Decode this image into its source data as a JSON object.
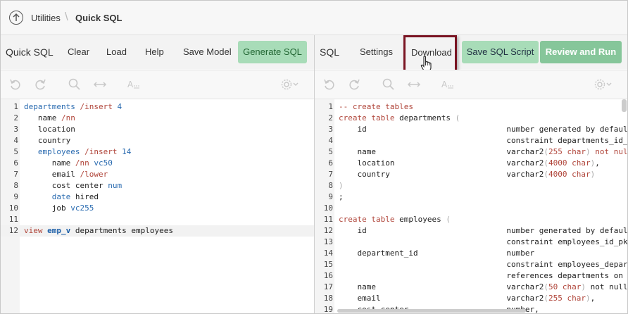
{
  "breadcrumb": {
    "parent": "Utilities",
    "current": "Quick SQL"
  },
  "left_toolbar": {
    "title": "Quick SQL",
    "clear": "Clear",
    "load": "Load",
    "help": "Help",
    "save_model": "Save Model",
    "generate": "Generate SQL"
  },
  "right_toolbar": {
    "title": "SQL",
    "settings": "Settings",
    "download": "Download",
    "save_script": "Save SQL Script",
    "review_run": "Review and Run"
  },
  "colors": {
    "accent_green": "#a8dcb8",
    "run_green": "#86c69a",
    "highlight_border": "#7a1422"
  },
  "left_code": [
    {
      "n": "1",
      "parts": [
        [
          "kw",
          "departments"
        ],
        [
          "red",
          " /insert "
        ],
        [
          "num",
          "4"
        ]
      ]
    },
    {
      "n": "2",
      "parts": [
        [
          "pl",
          "   name "
        ],
        [
          "red",
          "/nn"
        ]
      ]
    },
    {
      "n": "3",
      "parts": [
        [
          "pl",
          "   location"
        ]
      ]
    },
    {
      "n": "4",
      "parts": [
        [
          "pl",
          "   country"
        ]
      ]
    },
    {
      "n": "5",
      "parts": [
        [
          "kw",
          "   employees"
        ],
        [
          "red",
          " /insert "
        ],
        [
          "num",
          "14"
        ]
      ]
    },
    {
      "n": "6",
      "parts": [
        [
          "pl",
          "      name "
        ],
        [
          "red",
          "/nn "
        ],
        [
          "kw",
          "vc50"
        ]
      ]
    },
    {
      "n": "7",
      "parts": [
        [
          "pl",
          "      email "
        ],
        [
          "red",
          "/lower"
        ]
      ]
    },
    {
      "n": "8",
      "parts": [
        [
          "pl",
          "      cost center "
        ],
        [
          "kw",
          "num"
        ]
      ]
    },
    {
      "n": "9",
      "parts": [
        [
          "kw",
          "      date"
        ],
        [
          "pl",
          " hired"
        ]
      ]
    },
    {
      "n": "10",
      "parts": [
        [
          "pl",
          "      job "
        ],
        [
          "kw",
          "vc255"
        ]
      ]
    },
    {
      "n": "11",
      "parts": []
    },
    {
      "n": "12",
      "parts": [
        [
          "red",
          "view "
        ],
        [
          "kwb",
          "emp_v"
        ],
        [
          "pl",
          " departments employees"
        ]
      ]
    }
  ],
  "right_code": [
    {
      "n": "1",
      "parts": [
        [
          "cm",
          "-- create tables"
        ]
      ]
    },
    {
      "n": "2",
      "parts": [
        [
          "red",
          "create table "
        ],
        [
          "pl",
          "departments "
        ],
        [
          "grey",
          "("
        ]
      ]
    },
    {
      "n": "3",
      "parts": [
        [
          "pl",
          "    id                              number generated by default"
        ]
      ]
    },
    {
      "n": "4",
      "parts": [
        [
          "pl",
          "                                    constraint departments_id_p"
        ]
      ]
    },
    {
      "n": "5",
      "parts": [
        [
          "pl",
          "    name                            varchar2"
        ],
        [
          "grey",
          "("
        ],
        [
          "red",
          "255 char"
        ],
        [
          "grey",
          ")"
        ],
        [
          "red",
          " not null"
        ]
      ]
    },
    {
      "n": "6",
      "parts": [
        [
          "pl",
          "    location                        varchar2"
        ],
        [
          "grey",
          "("
        ],
        [
          "red",
          "4000 char"
        ],
        [
          "grey",
          ")"
        ],
        [
          "pl",
          ","
        ]
      ]
    },
    {
      "n": "7",
      "parts": [
        [
          "pl",
          "    country                         varchar2"
        ],
        [
          "grey",
          "("
        ],
        [
          "red",
          "4000 char"
        ],
        [
          "grey",
          ")"
        ]
      ]
    },
    {
      "n": "8",
      "parts": [
        [
          "grey",
          ")"
        ]
      ]
    },
    {
      "n": "9",
      "parts": [
        [
          "pl",
          ";"
        ]
      ]
    },
    {
      "n": "10",
      "parts": []
    },
    {
      "n": "11",
      "parts": [
        [
          "red",
          "create table "
        ],
        [
          "pl",
          "employees "
        ],
        [
          "grey",
          "("
        ]
      ]
    },
    {
      "n": "12",
      "parts": [
        [
          "pl",
          "    id                              number generated by default"
        ]
      ]
    },
    {
      "n": "13",
      "parts": [
        [
          "pl",
          "                                    constraint employees_id_pk "
        ],
        [
          "red",
          "p"
        ]
      ]
    },
    {
      "n": "14",
      "parts": [
        [
          "pl",
          "    department_id                   number"
        ]
      ]
    },
    {
      "n": "15",
      "parts": [
        [
          "pl",
          "                                    constraint employees_departm"
        ]
      ]
    },
    {
      "n": "16",
      "parts": [
        [
          "pl",
          "                                    references departments on d"
        ]
      ]
    },
    {
      "n": "17",
      "parts": [
        [
          "pl",
          "    name                            varchar2"
        ],
        [
          "grey",
          "("
        ],
        [
          "red",
          "50 char"
        ],
        [
          "grey",
          ")"
        ],
        [
          "pl",
          " not null,"
        ]
      ]
    },
    {
      "n": "18",
      "parts": [
        [
          "pl",
          "    email                           varchar2"
        ],
        [
          "grey",
          "("
        ],
        [
          "red",
          "255 char"
        ],
        [
          "grey",
          ")"
        ],
        [
          "pl",
          ","
        ]
      ]
    },
    {
      "n": "19",
      "parts": [
        [
          "pl",
          "    cost_center                     number,"
        ]
      ]
    }
  ]
}
